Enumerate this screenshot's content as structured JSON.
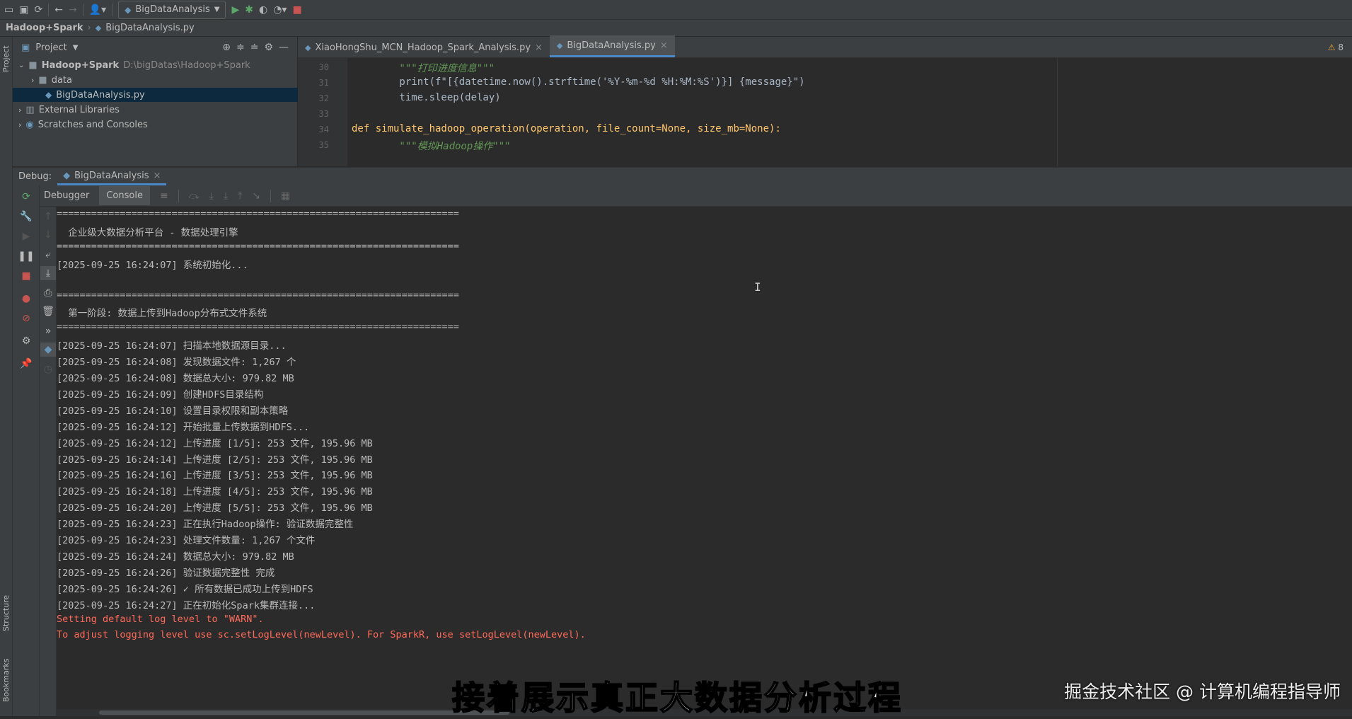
{
  "toolbar": {
    "run_config": "BigDataAnalysis"
  },
  "breadcrumb": {
    "project": "Hadoop+Spark",
    "file": "BigDataAnalysis.py"
  },
  "left_strip": {
    "project": "Project",
    "structure": "Structure",
    "bookmarks": "Bookmarks"
  },
  "project_panel": {
    "title": "Project",
    "root_name": "Hadoop+Spark",
    "root_path": "D:\\bigDatas\\Hadoop+Spark",
    "folder_data": "data",
    "file_selected": "BigDataAnalysis.py",
    "external_libraries": "External Libraries",
    "scratches": "Scratches and Consoles"
  },
  "editor": {
    "tabs": [
      {
        "label": "XiaoHongShu_MCN_Hadoop_Spark_Analysis.py"
      },
      {
        "label": "BigDataAnalysis.py"
      }
    ],
    "warning_count": "8",
    "lines": [
      {
        "num": "30",
        "text": "        \"\"\"打印进度信息\"\"\""
      },
      {
        "num": "31",
        "text": "        print(f\"[{datetime.now().strftime('%Y-%m-%d %H:%M:%S')}] {message}\")"
      },
      {
        "num": "32",
        "text": "        time.sleep(delay)"
      },
      {
        "num": "33",
        "text": ""
      },
      {
        "num": "34",
        "text": "def simulate_hadoop_operation(operation, file_count=None, size_mb=None):"
      },
      {
        "num": "35",
        "text": "        \"\"\"模拟Hadoop操作\"\"\""
      }
    ]
  },
  "debug": {
    "title": "Debug:",
    "session": "BigDataAnalysis",
    "tab_debugger": "Debugger",
    "tab_console": "Console"
  },
  "console": {
    "lines": [
      {
        "text": "======================================================================",
        "err": false
      },
      {
        "text": "  企业级大数据分析平台 - 数据处理引擎",
        "err": false
      },
      {
        "text": "======================================================================",
        "err": false
      },
      {
        "text": "[2025-09-25 16:24:07] 系统初始化...",
        "err": false
      },
      {
        "text": "",
        "err": false
      },
      {
        "text": "======================================================================",
        "err": false
      },
      {
        "text": "  第一阶段: 数据上传到Hadoop分布式文件系统",
        "err": false
      },
      {
        "text": "======================================================================",
        "err": false
      },
      {
        "text": "[2025-09-25 16:24:07] 扫描本地数据源目录...",
        "err": false
      },
      {
        "text": "[2025-09-25 16:24:08] 发现数据文件: 1,267 个",
        "err": false
      },
      {
        "text": "[2025-09-25 16:24:08] 数据总大小: 979.82 MB",
        "err": false
      },
      {
        "text": "[2025-09-25 16:24:09] 创建HDFS目录结构",
        "err": false
      },
      {
        "text": "[2025-09-25 16:24:10] 设置目录权限和副本策略",
        "err": false
      },
      {
        "text": "[2025-09-25 16:24:12] 开始批量上传数据到HDFS...",
        "err": false
      },
      {
        "text": "[2025-09-25 16:24:12] 上传进度 [1/5]: 253 文件, 195.96 MB",
        "err": false
      },
      {
        "text": "[2025-09-25 16:24:14] 上传进度 [2/5]: 253 文件, 195.96 MB",
        "err": false
      },
      {
        "text": "[2025-09-25 16:24:16] 上传进度 [3/5]: 253 文件, 195.96 MB",
        "err": false
      },
      {
        "text": "[2025-09-25 16:24:18] 上传进度 [4/5]: 253 文件, 195.96 MB",
        "err": false
      },
      {
        "text": "[2025-09-25 16:24:20] 上传进度 [5/5]: 253 文件, 195.96 MB",
        "err": false
      },
      {
        "text": "[2025-09-25 16:24:23] 正在执行Hadoop操作: 验证数据完整性",
        "err": false
      },
      {
        "text": "[2025-09-25 16:24:23] 处理文件数量: 1,267 个文件",
        "err": false
      },
      {
        "text": "[2025-09-25 16:24:24] 数据总大小: 979.82 MB",
        "err": false
      },
      {
        "text": "[2025-09-25 16:24:26] 验证数据完整性 完成",
        "err": false
      },
      {
        "text": "[2025-09-25 16:24:26] ✓ 所有数据已成功上传到HDFS",
        "err": false
      },
      {
        "text": "[2025-09-25 16:24:27] 正在初始化Spark集群连接...",
        "err": false
      },
      {
        "text": "Setting default log level to \"WARN\".",
        "err": true
      },
      {
        "text": "To adjust logging level use sc.setLogLevel(newLevel). For SparkR, use setLogLevel(newLevel).",
        "err": true
      }
    ]
  },
  "overlay": {
    "subtitle": "接着展示真正大数据分析过程",
    "watermark": "掘金技术社区 @ 计算机编程指导师"
  },
  "colors": {
    "keyword": "#cc7832",
    "function": "#ffc66d",
    "string": "#6a8759",
    "docstring": "#629755",
    "error_text": "#ff6b5b",
    "accent": "#4a88c7"
  }
}
